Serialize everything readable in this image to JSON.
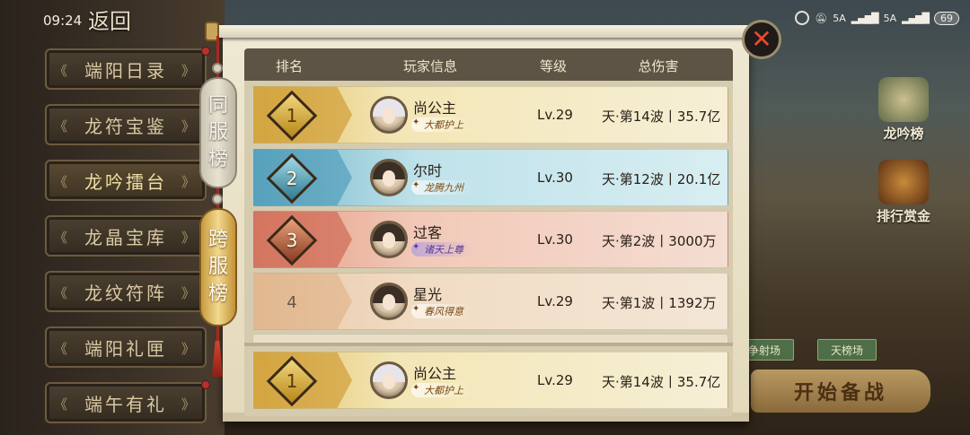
{
  "status_bar": {
    "time": "09:24",
    "network1": "5A",
    "network2": "5A",
    "battery": "69"
  },
  "nav": {
    "back_label": "返回"
  },
  "left_menu": [
    {
      "label": "端阳日录",
      "active": false
    },
    {
      "label": "龙符宝鉴",
      "active": false
    },
    {
      "label": "龙吟擂台",
      "active": true
    },
    {
      "label": "龙晶宝库",
      "active": false
    },
    {
      "label": "龙纹符阵",
      "active": false
    },
    {
      "label": "端阳礼匣",
      "active": false
    },
    {
      "label": "端午有礼",
      "active": false
    }
  ],
  "tabs": {
    "same_server": [
      "同",
      "服",
      "榜"
    ],
    "cross_server": [
      "跨",
      "服",
      "榜"
    ]
  },
  "table": {
    "headers": {
      "rank": "排名",
      "player": "玩家信息",
      "level": "等级",
      "damage": "总伤害"
    },
    "rows": [
      {
        "rank": "1",
        "name": "尚公主",
        "title": "大都护上",
        "level": "Lv.29",
        "damage": "天·第14波丨35.7亿",
        "style": "gold",
        "avatar": "white"
      },
      {
        "rank": "2",
        "name": "尔时",
        "title": "龙腾九州",
        "level": "Lv.30",
        "damage": "天·第12波丨20.1亿",
        "style": "blue",
        "avatar": "dark"
      },
      {
        "rank": "3",
        "name": "过客",
        "title": "诸天上尊",
        "level": "Lv.30",
        "damage": "天·第2波丨3000万",
        "style": "bronze",
        "avatar": "dark"
      },
      {
        "rank": "4",
        "name": "星光",
        "title": "春风得意",
        "level": "Lv.29",
        "damage": "天·第1波丨1392万",
        "style": "plain",
        "avatar": "dark"
      }
    ],
    "my_row": {
      "rank": "1",
      "name": "尚公主",
      "title": "大都护上",
      "level": "Lv.29",
      "damage": "天·第14波丨35.7亿"
    }
  },
  "right_panel": {
    "ranking_btn": "龙吟榜",
    "reward_btn": "排行赏金",
    "tab_a": "争射场",
    "tab_b": "天榜场",
    "start_btn": "开始备战"
  },
  "colors": {
    "gold": "#e2c16a",
    "blue": "#72b7c9",
    "bronze": "#e59b86",
    "close_x": "#e84a2f"
  },
  "icons": [
    "close-icon",
    "scroll-icon",
    "treasure-chest-icon",
    "alarm-icon",
    "mute-icon",
    "signal-icon",
    "battery-icon"
  ]
}
